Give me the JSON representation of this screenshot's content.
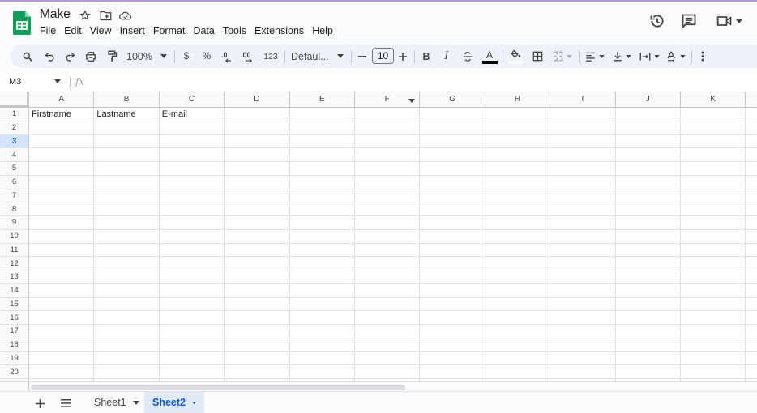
{
  "document": {
    "title": "Make"
  },
  "menu": [
    "File",
    "Edit",
    "View",
    "Insert",
    "Format",
    "Data",
    "Tools",
    "Extensions",
    "Help"
  ],
  "toolbar": {
    "zoom": "100%",
    "currency": "$",
    "percent": "%",
    "decrease_decimal": ".0",
    "increase_decimal": ".00",
    "number_format": "123",
    "font": "Defaul...",
    "font_size": "10",
    "bold": "B",
    "italic": "I",
    "text_color_label": "A",
    "text_color": "#000000"
  },
  "formula_bar": {
    "name_box": "M3",
    "fx": "fx",
    "formula": ""
  },
  "grid": {
    "columns": [
      "A",
      "B",
      "C",
      "D",
      "E",
      "F",
      "G",
      "H",
      "I",
      "J",
      "K"
    ],
    "rows": [
      "1",
      "2",
      "3",
      "4",
      "5",
      "6",
      "7",
      "8",
      "9",
      "10",
      "11",
      "12",
      "13",
      "14",
      "15",
      "16",
      "17",
      "18",
      "19",
      "20"
    ],
    "selected_row": "3",
    "cells": {
      "A1": "Firstname",
      "B1": "Lastname",
      "C1": "E-mail"
    }
  },
  "sheets": {
    "tabs": [
      {
        "label": "Sheet1",
        "active": false
      },
      {
        "label": "Sheet2",
        "active": true
      }
    ]
  },
  "colors": {
    "accent": "#0b57d0",
    "selected_header": "#d3e3fd",
    "logo_green": "#0f9d58"
  }
}
